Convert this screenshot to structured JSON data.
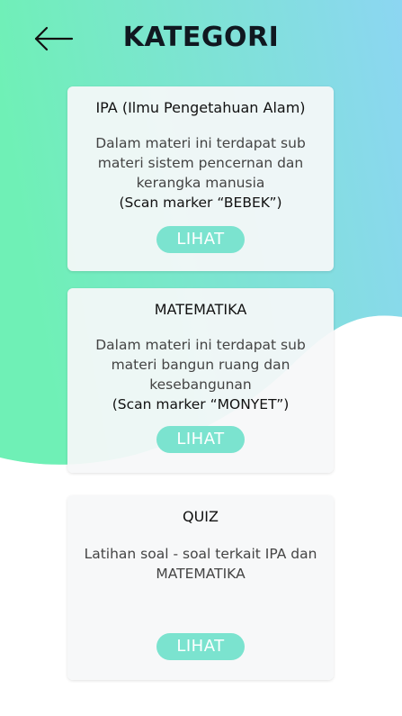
{
  "header": {
    "title": "KATEGORI",
    "back_icon": "arrow-left-icon"
  },
  "colors": {
    "gradient_teal": "#6ff0b4",
    "gradient_blue": "#8ad8f0",
    "button": "#7be3cf",
    "card": "#f6f8f9"
  },
  "cards": [
    {
      "heading": "IPA (Ilmu Pengetahuan Alam)",
      "description": "Dalam materi ini terdapat sub materi sistem pencernan dan kerangka manusia",
      "scan": "(Scan marker “BEBEK”)",
      "button": "LIHAT"
    },
    {
      "heading": "MATEMATIKA",
      "description": "Dalam materi ini terdapat sub materi bangun ruang dan kesebangunan",
      "scan": "(Scan marker “MONYET”)",
      "button": "LIHAT"
    },
    {
      "heading": "QUIZ",
      "description": "Latihan soal - soal terkait IPA dan MATEMATIKA",
      "button": "LIHAT"
    }
  ]
}
